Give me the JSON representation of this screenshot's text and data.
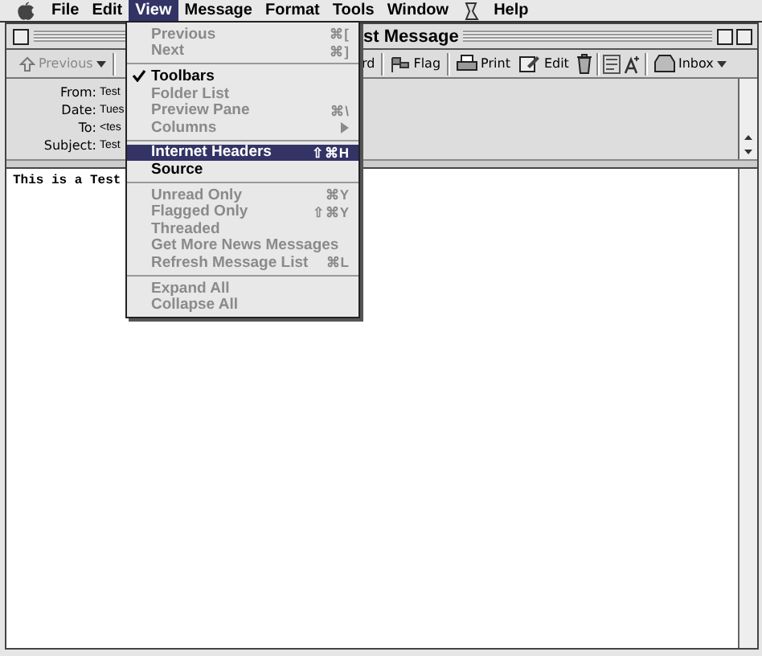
{
  "menubar": {
    "items": [
      {
        "label": "File",
        "selected": false
      },
      {
        "label": "Edit",
        "selected": false
      },
      {
        "label": "View",
        "selected": true
      },
      {
        "label": "Message",
        "selected": false
      },
      {
        "label": "Format",
        "selected": false
      },
      {
        "label": "Tools",
        "selected": false
      },
      {
        "label": "Window",
        "selected": false
      },
      {
        "label": "Help",
        "selected": false
      }
    ]
  },
  "window": {
    "title": "st Message"
  },
  "toolbar": {
    "left": [
      {
        "kind": "previous",
        "label": "Previous"
      }
    ],
    "right": [
      {
        "kind": "forward",
        "label": "rd"
      },
      {
        "kind": "flag",
        "label": "Flag"
      },
      {
        "kind": "print",
        "label": "Print"
      },
      {
        "kind": "edit",
        "label": "Edit"
      },
      {
        "kind": "trash"
      },
      {
        "kind": "junk"
      },
      {
        "kind": "font"
      },
      {
        "kind": "inbox",
        "label": "Inbox"
      }
    ]
  },
  "headers": [
    {
      "label": "From:",
      "value": "Test"
    },
    {
      "label": "Date:",
      "value": "Tues"
    },
    {
      "label": "To:",
      "value": "<tes"
    },
    {
      "label": "Subject:",
      "value": "Test"
    }
  ],
  "body": {
    "text": "This is a Test"
  },
  "menu": {
    "items": [
      {
        "kind": "item",
        "label": "Previous",
        "shortcut": "⌘[",
        "disabled": true,
        "checked": false,
        "selected": false
      },
      {
        "kind": "item",
        "label": "Next",
        "shortcut": "⌘]",
        "disabled": true,
        "checked": false,
        "selected": false
      },
      {
        "kind": "separator"
      },
      {
        "kind": "item",
        "label": "Toolbars",
        "disabled": false,
        "checked": true,
        "selected": false
      },
      {
        "kind": "item",
        "label": "Folder List",
        "disabled": true,
        "checked": false,
        "selected": false
      },
      {
        "kind": "item",
        "label": "Preview Pane",
        "shortcut": "⌘\\",
        "disabled": true,
        "checked": false,
        "selected": false
      },
      {
        "kind": "submenu",
        "label": "Columns",
        "disabled": true,
        "checked": false,
        "selected": false
      },
      {
        "kind": "separator"
      },
      {
        "kind": "item",
        "label": "Internet Headers",
        "shortcut": "⇧⌘H",
        "disabled": false,
        "checked": false,
        "selected": true
      },
      {
        "kind": "item",
        "label": "Source",
        "disabled": false,
        "checked": false,
        "selected": false
      },
      {
        "kind": "separator"
      },
      {
        "kind": "item",
        "label": "Unread Only",
        "shortcut": "⌘Y",
        "disabled": true,
        "checked": false,
        "selected": false
      },
      {
        "kind": "item",
        "label": "Flagged Only",
        "shortcut": "⇧⌘Y",
        "disabled": true,
        "checked": false,
        "selected": false
      },
      {
        "kind": "item",
        "label": "Threaded",
        "disabled": true,
        "checked": false,
        "selected": false
      },
      {
        "kind": "item",
        "label": "Get More News Messages",
        "disabled": true,
        "checked": false,
        "selected": false
      },
      {
        "kind": "item",
        "label": "Refresh Message List",
        "shortcut": "⌘L",
        "disabled": true,
        "checked": false,
        "selected": false
      },
      {
        "kind": "separator"
      },
      {
        "kind": "item",
        "label": "Expand All",
        "disabled": true,
        "checked": false,
        "selected": false
      },
      {
        "kind": "item",
        "label": "Collapse All",
        "disabled": true,
        "checked": false,
        "selected": false
      }
    ]
  }
}
